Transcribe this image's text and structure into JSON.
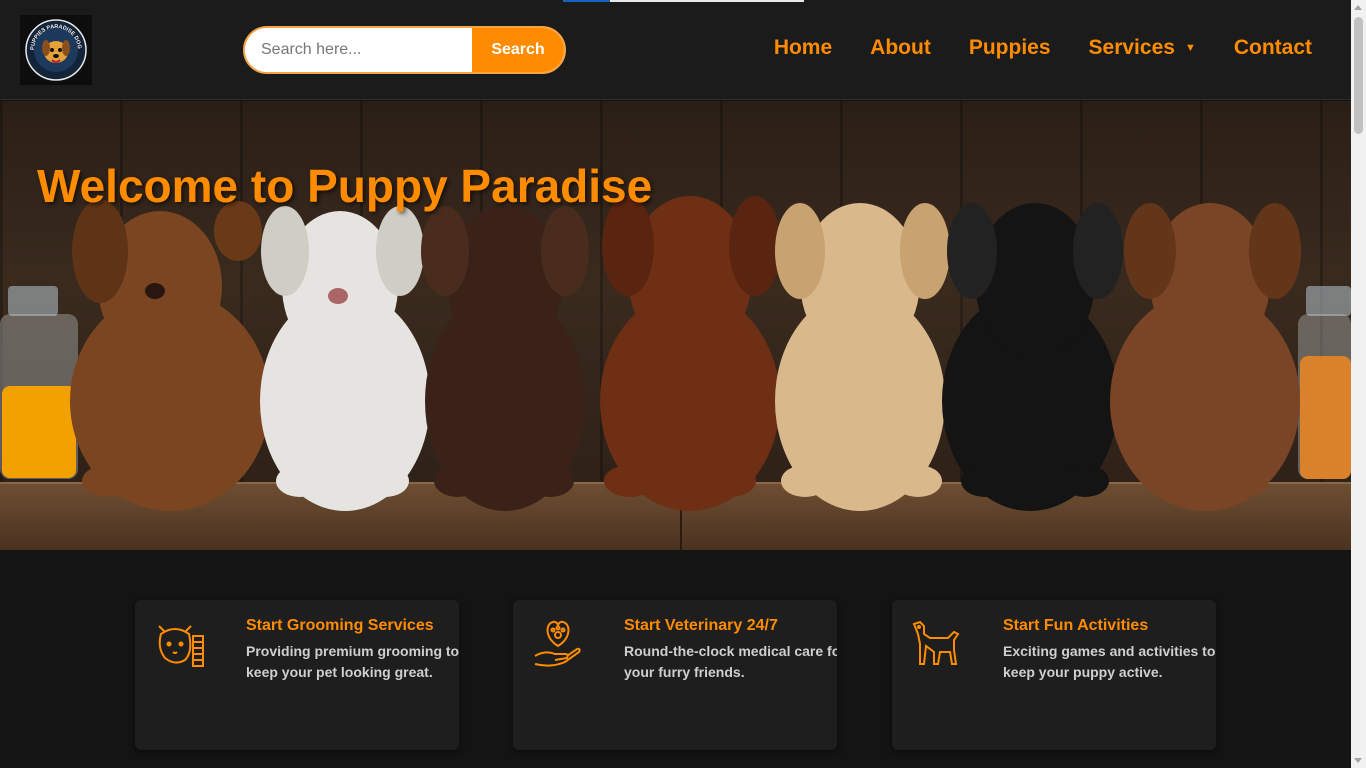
{
  "header": {
    "logo_text": "PUPPIES PARADISE DOGS",
    "search": {
      "placeholder": "Search here...",
      "button_label": "Search"
    },
    "nav": [
      {
        "label": "Home"
      },
      {
        "label": "About"
      },
      {
        "label": "Puppies"
      },
      {
        "label": "Services",
        "has_dropdown": true
      },
      {
        "label": "Contact"
      }
    ]
  },
  "hero": {
    "title": "Welcome to Puppy Paradise"
  },
  "services": [
    {
      "title": "Start Grooming Services",
      "description": "Providing premium grooming to keep your pet looking great.",
      "icon": "grooming-icon"
    },
    {
      "title": "Start Veterinary 24/7",
      "description": "Round-the-clock medical care for your furry friends.",
      "icon": "veterinary-paw-heart-icon"
    },
    {
      "title": "Start Fun Activities",
      "description": "Exciting games and activities to keep your puppy active.",
      "icon": "dog-icon"
    }
  ],
  "colors": {
    "accent": "#ff8c00",
    "background": "#141414",
    "header": "#1b1b1b",
    "card": "#1e1e1e"
  }
}
